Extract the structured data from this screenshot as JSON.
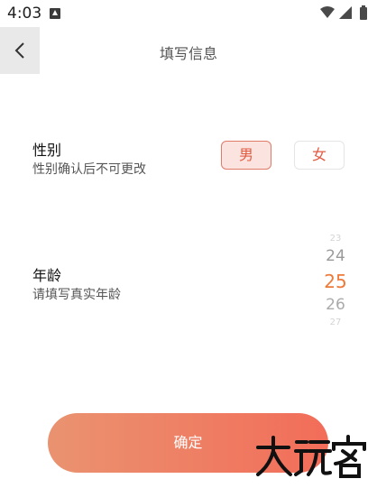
{
  "status_bar": {
    "time": "4:03"
  },
  "header": {
    "title": "填写信息"
  },
  "gender": {
    "title": "性别",
    "subtitle": "性别确认后不可更改",
    "options": [
      {
        "label": "男",
        "selected": true
      },
      {
        "label": "女",
        "selected": false
      }
    ]
  },
  "age": {
    "title": "年龄",
    "subtitle": "请填写真实年龄",
    "picker_values": [
      "23",
      "24",
      "25",
      "26",
      "27"
    ],
    "selected_value": "25"
  },
  "confirm_label": "确定",
  "watermark_text": "大玩客",
  "colors": {
    "accent": "#ee7a3a",
    "button_gradient_start": "#ea9370",
    "button_gradient_end": "#f26d59",
    "selected_bg": "#fbe3df",
    "selected_border": "#e07b6a"
  }
}
